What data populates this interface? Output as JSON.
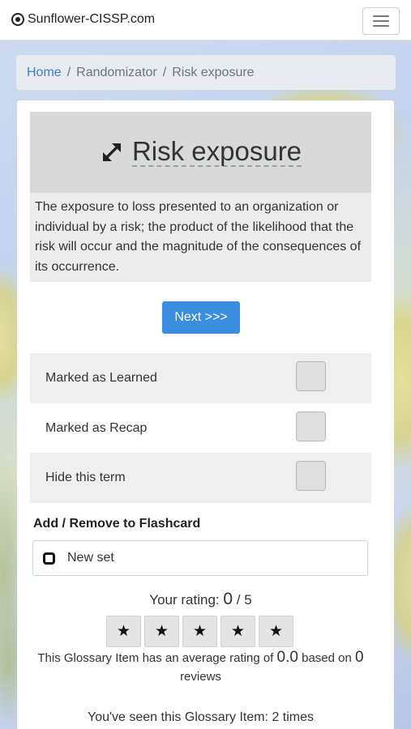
{
  "brand": {
    "name": "Sunflower-CISSP.com",
    "icon": "sunflower-logo-icon"
  },
  "navbar": {
    "menu_icon": "hamburger-icon"
  },
  "breadcrumb": {
    "home": "Home",
    "sep1": "/",
    "middle": "Randomizator",
    "sep2": "/",
    "current": "Risk exposure"
  },
  "term": {
    "title": "Risk exposure",
    "icon": "expand-arrows-icon",
    "definition": "The exposure to loss presented to an organization or individual by a risk; the product of the likelihood that the risk will occur and the magnitude of the consequences of its occurrence."
  },
  "next_label": "Next >>>",
  "options": [
    {
      "label": "Marked as Learned",
      "checked": false
    },
    {
      "label": "Marked as Recap",
      "checked": false
    },
    {
      "label": "Hide this term",
      "checked": false
    }
  ],
  "flashcard": {
    "title": "Add / Remove to Flashcard",
    "set_name": "New set"
  },
  "rating": {
    "prefix": "Your rating:",
    "value": "0",
    "suffix": "/ 5",
    "stars": [
      "★",
      "★",
      "★",
      "★",
      "★"
    ],
    "avg_prefix": "This Glossary Item has an average rating of",
    "avg_value": "0.0",
    "avg_mid": "based on",
    "review_count": "0",
    "avg_suffix": "reviews"
  },
  "seen": {
    "text": "You've seen this Glossary Item: 2 times"
  },
  "colors": {
    "accent": "#3b8de0",
    "link": "#3b7dd8",
    "header_bg": "#d9d9d9"
  }
}
